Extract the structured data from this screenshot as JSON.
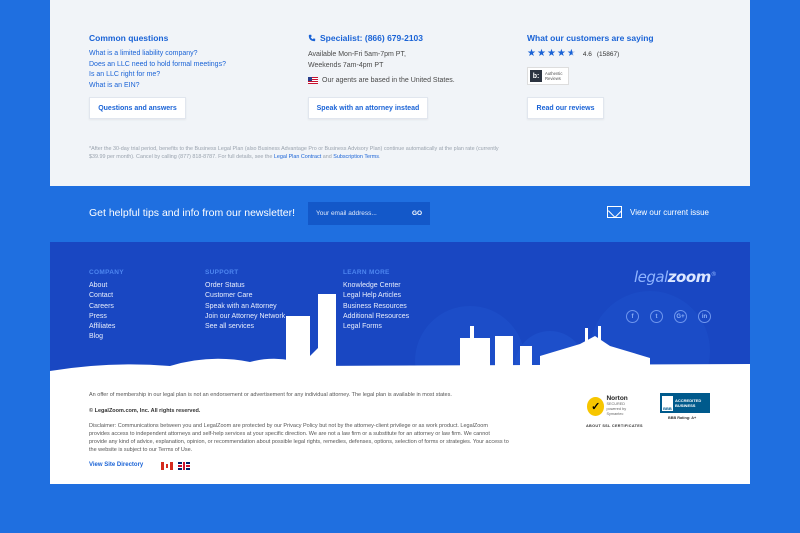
{
  "faq": {
    "title": "Common questions",
    "links": [
      "What is a limited liability company?",
      "Does an LLC need to hold formal meetings?",
      "Is an LLC right for me?",
      "What is an EIN?"
    ],
    "button": "Questions and answers"
  },
  "specialist": {
    "title": "Specialist: (866) 679-2103",
    "hours1": "Available Mon-Fri 5am-7pm PT,",
    "hours2": "Weekends 7am-4pm PT",
    "location_note": "Our agents are based in the United States.",
    "button": "Speak with an attorney instead"
  },
  "reviews": {
    "title": "What our customers are saying",
    "stars": 4.6,
    "rating": "4.6",
    "count": "(15867)",
    "badge_text_1": "Authentic",
    "badge_text_2": "Reviews",
    "button": "Read our reviews"
  },
  "fineprint": {
    "text": "*After the 30-day trial period, benefits to the Business Legal Plan (also Business Advantage Pro or Business Advisory Plan) continue automatically at the plan rate (currently $39.99 per month). Cancel by calling (877) 818-8787. For full details, see the ",
    "link1": "Legal Plan Contract",
    "and": " and ",
    "link2": "Subscription Terms",
    "end": "."
  },
  "newsletter": {
    "text": "Get helpful tips and info from our newsletter!",
    "placeholder": "Your email address...",
    "go": "GO",
    "issue": "View our current issue"
  },
  "footer": {
    "company": {
      "head": "COMPANY",
      "links": [
        "About",
        "Contact",
        "Careers",
        "Press",
        "Affiliates",
        "Blog"
      ]
    },
    "support": {
      "head": "SUPPORT",
      "links": [
        "Order Status",
        "Customer Care",
        "Speak with an Attorney",
        "Join our Attorney Network",
        "See all services"
      ]
    },
    "learn": {
      "head": "LEARN MORE",
      "links": [
        "Knowledge Center",
        "Legal Help Articles",
        "Business Resources",
        "Additional Resources",
        "Legal Forms"
      ]
    },
    "logo_light": "legal",
    "logo_bold": "zoom",
    "logo_mark": "®",
    "social": [
      "f",
      "t",
      "G+",
      "in"
    ]
  },
  "legal": {
    "membership": "An offer of membership in our legal plan is not an endorsement or advertisement for any individual attorney. The legal plan is available in most states.",
    "copyright": "© LegalZoom.com, Inc. All rights reserved.",
    "disclaimer": "Disclaimer: Communications between you and LegalZoom are protected by our Privacy Policy but not by the attorney-client privilege or as work product. LegalZoom provides access to independent attorneys and self-help services at your specific direction. We are not a law firm or a substitute for an attorney or law firm. We cannot provide any kind of advice, explanation, opinion, or recommendation about possible legal rights, remedies, defenses, options, selection of forms or strategies. Your access to the website is subject to our Terms of Use.",
    "site_directory": "View Site Directory",
    "norton_name": "Norton",
    "norton_secured": "SECURED",
    "norton_by": "powered by Symantec",
    "ssl": "ABOUT SSL CERTIFICATES",
    "bbb_logo": "BBB",
    "bbb_1": "ACCREDITED",
    "bbb_2": "BUSINESS",
    "bbb_rating": "BBB Rating: A+"
  }
}
